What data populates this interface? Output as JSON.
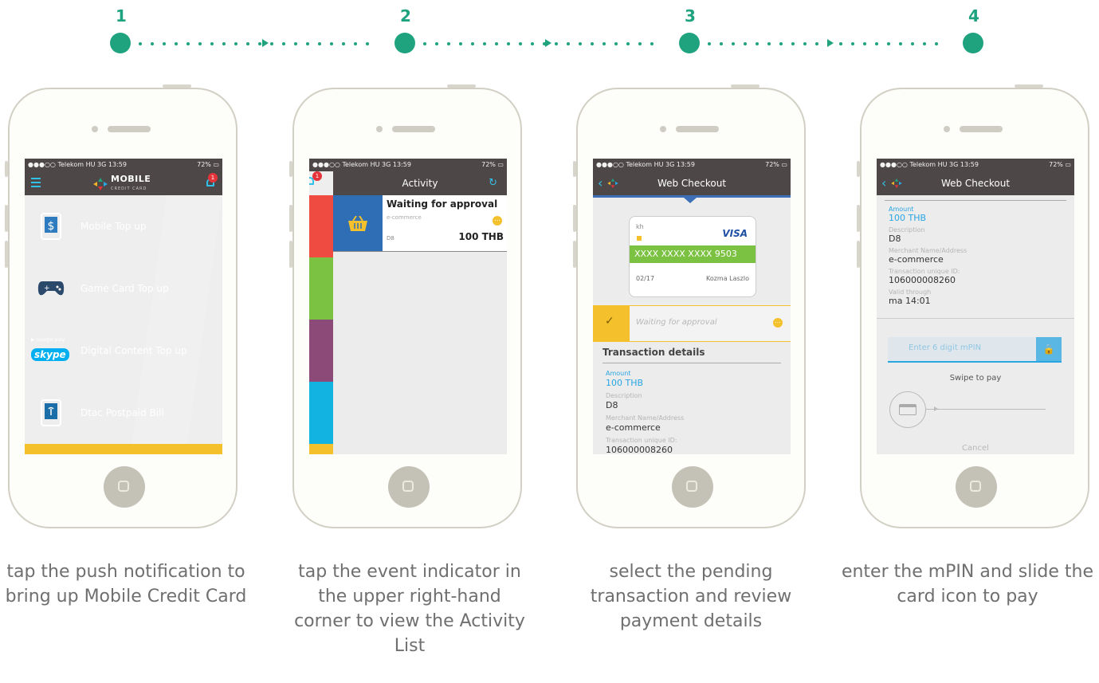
{
  "steps": [
    "1",
    "2",
    "3",
    "4"
  ],
  "status": {
    "carrier": "●●●○○ Telekom HU  3G  13:59",
    "battery": "72%"
  },
  "phone1": {
    "logo_title": "MOBILE",
    "logo_sub": "CREDIT CARD",
    "badge": "1",
    "items": [
      {
        "label": "Mobile Top up",
        "color": "#ef4b41"
      },
      {
        "label": "Game Card Top up",
        "color": "#7cc242"
      },
      {
        "label": "Digital Content Top up",
        "color": "#8b4a77"
      },
      {
        "label": "Dtac Postpaid Bill",
        "color": "#12b2e1"
      }
    ],
    "google_play": "Google play",
    "skype": "skype"
  },
  "phone2": {
    "badge": "1",
    "title": "Activity",
    "event": {
      "title": "Waiting for approval",
      "type": "e-commerce",
      "ref": "D8",
      "amount": "100 THB"
    }
  },
  "phone3": {
    "title": "Web Checkout",
    "card": {
      "holder_initials": "kh",
      "brand": "VISA",
      "number": "XXXX XXXX XXXX 9503",
      "expiry": "02/17",
      "name": "Kozma Laszlo"
    },
    "pending": "Waiting for approval",
    "details_title": "Transaction details",
    "amount_label": "Amount",
    "amount": "100 THB",
    "desc_label": "Description",
    "desc": "D8",
    "merchant_label": "Merchant Name/Address",
    "merchant": "e-commerce",
    "txn_label": "Transaction unique ID:",
    "txn": "106000008260"
  },
  "phone4": {
    "title": "Web Checkout",
    "amount_label": "Amount",
    "amount": "100 THB",
    "desc_label": "Description",
    "desc": "D8",
    "merchant_label": "Merchant Name/Address",
    "merchant": "e-commerce",
    "txn_label": "Transaction unique ID:",
    "txn": "106000008260",
    "valid_label": "Valid through",
    "valid": "ma 14:01",
    "pin_placeholder": "Enter 6 digit mPIN",
    "swipe": "Swipe to pay",
    "cancel": "Cancel"
  },
  "captions": [
    "tap the push notification to bring up Mobile Credit Card",
    "tap the event indicator in the upper right-hand corner to view the Activity List",
    "select the pending transaction and review payment details",
    "enter the mPIN and slide the card icon to pay"
  ]
}
